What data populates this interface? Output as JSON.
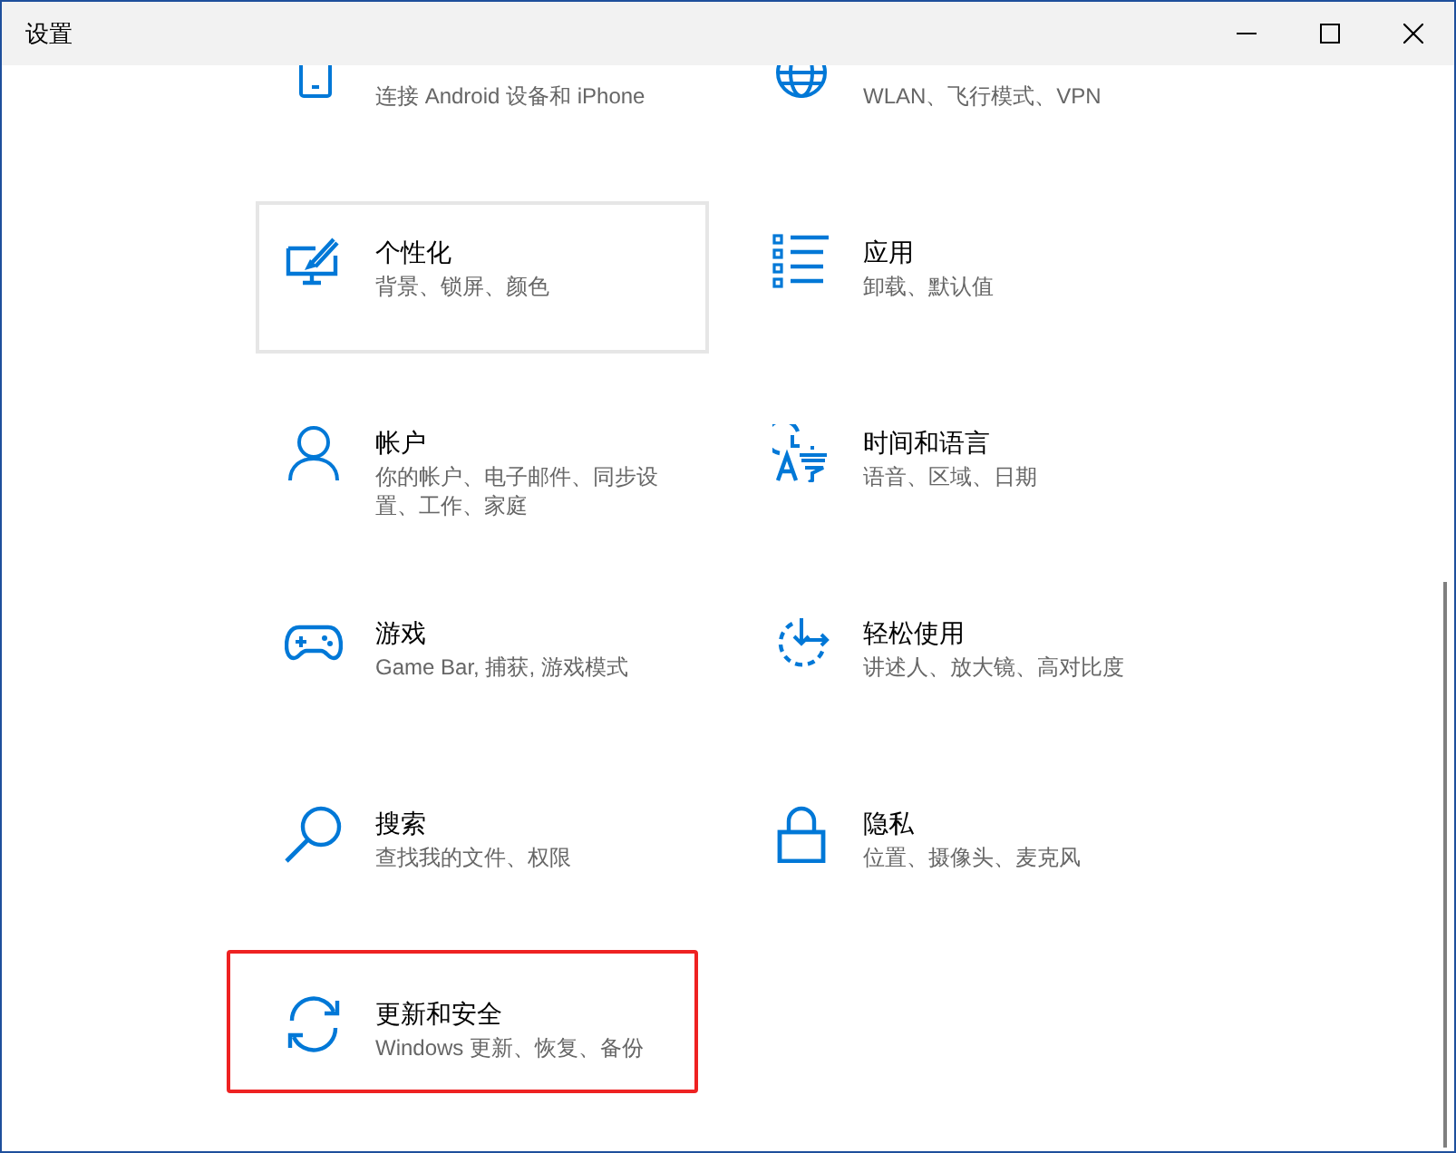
{
  "window": {
    "title": "设置"
  },
  "items": [
    {
      "kind": "phone",
      "subtitle": "连接 Android 设备和 iPhone"
    },
    {
      "kind": "globe",
      "subtitle": "WLAN、飞行模式、VPN"
    },
    {
      "kind": "brush",
      "title": "个性化",
      "subtitle": "背景、锁屏、颜色",
      "hovered": true,
      "highlighted": false
    },
    {
      "kind": "apps",
      "title": "应用",
      "subtitle": "卸载、默认值",
      "hovered": false,
      "highlighted": false
    },
    {
      "kind": "person",
      "title": "帐户",
      "subtitle": "你的帐户、电子邮件、同步设置、工作、家庭",
      "hovered": false,
      "highlighted": false
    },
    {
      "kind": "language",
      "title": "时间和语言",
      "subtitle": "语音、区域、日期",
      "hovered": false,
      "highlighted": false
    },
    {
      "kind": "gamepad",
      "title": "游戏",
      "subtitle": "Game Bar, 捕获, 游戏模式",
      "hovered": false,
      "highlighted": false
    },
    {
      "kind": "ease",
      "title": "轻松使用",
      "subtitle": "讲述人、放大镜、高对比度",
      "hovered": false,
      "highlighted": false
    },
    {
      "kind": "search",
      "title": "搜索",
      "subtitle": "查找我的文件、权限",
      "hovered": false,
      "highlighted": false
    },
    {
      "kind": "lock",
      "title": "隐私",
      "subtitle": "位置、摄像头、麦克风",
      "hovered": false,
      "highlighted": false
    },
    {
      "kind": "sync",
      "title": "更新和安全",
      "subtitle": "Windows 更新、恢复、备份",
      "hovered": false,
      "highlighted": true
    }
  ]
}
